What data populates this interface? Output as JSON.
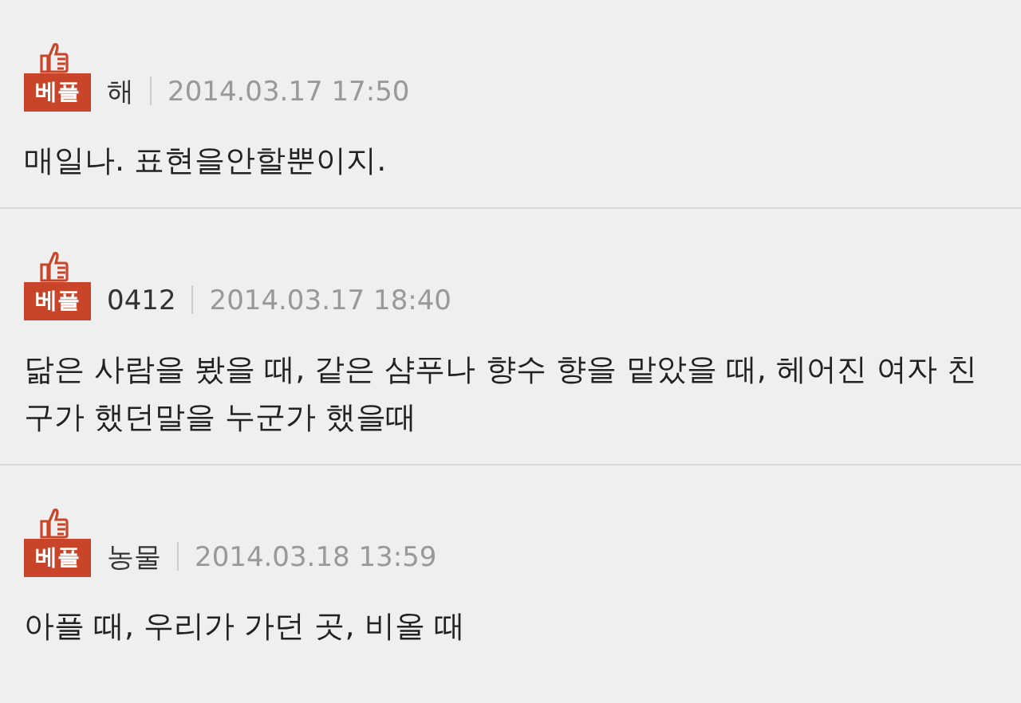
{
  "comments": [
    {
      "badge": "베플",
      "author": "해",
      "time": "2014.03.17 17:50",
      "text": "매일나. 표현을안할뿐이지."
    },
    {
      "badge": "베플",
      "author": "0412",
      "time": "2014.03.17 18:40",
      "text": "닮은 사람을 봤을 때, 같은 샴푸나 향수 향을 맡았을 때, 헤어진 여자 친구가 했던말을 누군가 했을때"
    },
    {
      "badge": "베플",
      "author": "농물",
      "time": "2014.03.18 13:59",
      "text": "아플 때, 우리가 가던 곳, 비올 때"
    }
  ]
}
